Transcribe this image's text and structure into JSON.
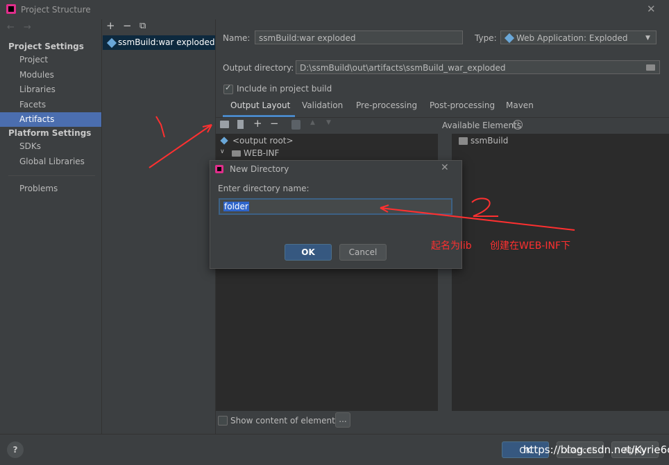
{
  "window": {
    "title": "Project Structure",
    "close_glyph": "✕"
  },
  "nav": {
    "back": "←",
    "forward": "→"
  },
  "sidebar": {
    "project_settings_header": "Project Settings",
    "project_items": [
      "Project",
      "Modules",
      "Libraries",
      "Facets",
      "Artifacts"
    ],
    "platform_settings_header": "Platform Settings",
    "platform_items": [
      "SDKs",
      "Global Libraries"
    ],
    "problems": "Problems"
  },
  "artifacts_panel": {
    "add": "+",
    "remove": "−",
    "copy": "⧉",
    "items": [
      "ssmBuild:war exploded"
    ]
  },
  "form": {
    "name_label": "Name:",
    "name_value": "ssmBuild:war exploded",
    "type_label": "Type:",
    "type_value": "Web Application: Exploded",
    "output_label": "Output directory:",
    "output_value": "D:\\ssmBuild\\out\\artifacts\\ssmBuild_war_exploded",
    "include_label": "Include in project build",
    "include_checked": true
  },
  "tabs": [
    "Output Layout",
    "Validation",
    "Pre-processing",
    "Post-processing",
    "Maven"
  ],
  "layout": {
    "available_label": "Available Elements",
    "tree": [
      "<output root>",
      "WEB-INF"
    ],
    "available_items": [
      "ssmBuild"
    ],
    "show_content_label": "Show content of elements",
    "ellipsis": "..."
  },
  "footer": {
    "help": "?",
    "ok": "OK",
    "cancel": "Cancel",
    "apply": "Apply"
  },
  "watermark": "https://blog.csdn.net/Kyrie6c",
  "dialog": {
    "title": "New Directory",
    "close_glyph": "✕",
    "prompt": "Enter directory name:",
    "input_value": "folder",
    "ok": "OK",
    "cancel": "Cancel"
  },
  "annotations": {
    "mark_1": "1",
    "mark_2": "2",
    "note_name": "起名为lib",
    "note_create": "创建在WEB-INF下"
  },
  "colors": {
    "accent": "#4b6eaf",
    "selection": "#0d293e",
    "annotation": "#ff3030",
    "primary_button": "#365880"
  }
}
